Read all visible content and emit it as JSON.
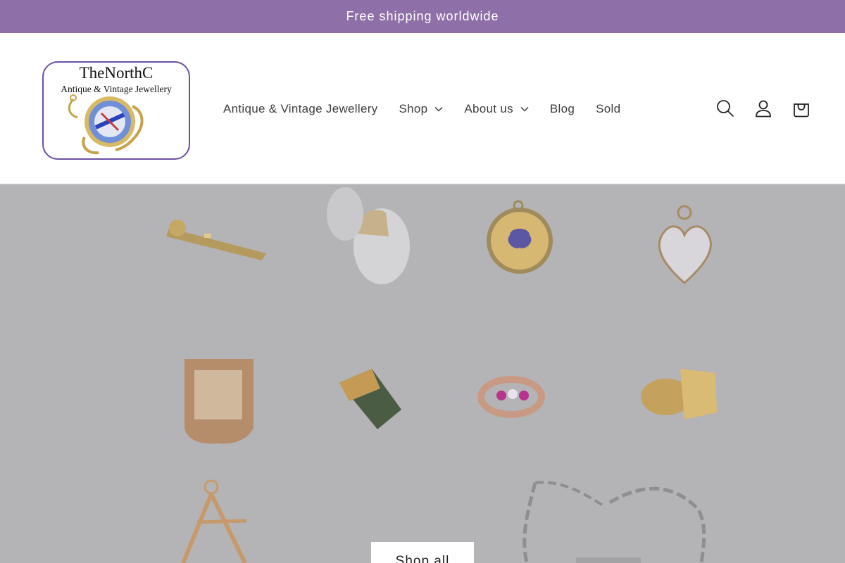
{
  "announcement": {
    "text": "Free shipping worldwide"
  },
  "logo": {
    "title": "TheNorthC",
    "subtitle": "Antique & Vintage Jewellery"
  },
  "nav": {
    "items": [
      {
        "label": "Antique & Vintage Jewellery",
        "has_dropdown": false
      },
      {
        "label": "Shop",
        "has_dropdown": true
      },
      {
        "label": "About us",
        "has_dropdown": true
      },
      {
        "label": "Blog",
        "has_dropdown": false
      },
      {
        "label": "Sold",
        "has_dropdown": false
      }
    ]
  },
  "header_icons": [
    "search-icon",
    "account-icon",
    "cart-icon"
  ],
  "hero": {
    "button_label": "Shop all",
    "overlay_color": "#b4b4b6",
    "products": [
      "whistle-pendant",
      "egg-vesta",
      "pansy-locket",
      "heart-locket",
      "vesta-case",
      "book-charm",
      "ruby-diamond-ring",
      "signet-ring",
      "masonic-fob",
      "albert-chain"
    ]
  },
  "colors": {
    "announcement_bg": "#8f6fa7",
    "logo_border": "#6b4fa3"
  }
}
